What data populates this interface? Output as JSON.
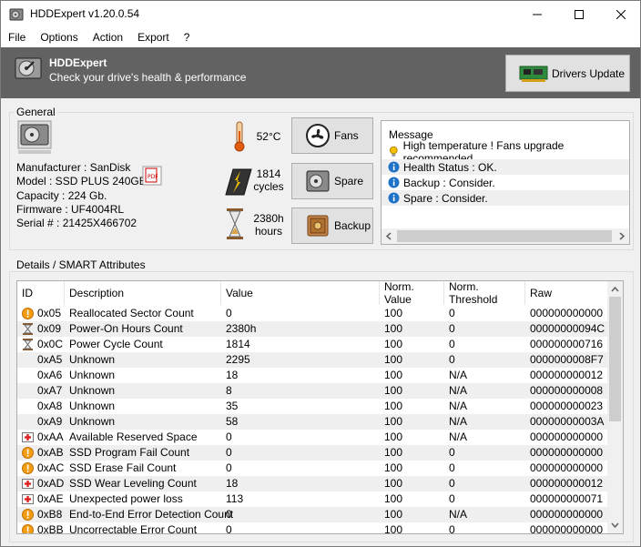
{
  "window": {
    "title": "HDDExpert v1.20.0.54"
  },
  "menu": [
    "File",
    "Options",
    "Action",
    "Export",
    "?"
  ],
  "banner": {
    "title": "HDDExpert",
    "subtitle": "Check your drive's health & performance",
    "drivers_button": "Drivers Update"
  },
  "general": {
    "label": "General",
    "manufacturer": "Manufacturer : SanDisk",
    "model": "Model : SSD PLUS 240GB",
    "capacity": "Capacity : 224 Gb.",
    "firmware": "Firmware : UF4004RL",
    "serial": "Serial # : 21425X466702",
    "temp": "52°C",
    "cycles_value": "1814",
    "cycles_unit": "cycles",
    "hours_value": "2380h",
    "hours_unit": "hours",
    "fans_button": "Fans",
    "spare_button": "Spare",
    "backup_button": "Backup"
  },
  "messages": {
    "header": "Message",
    "items": [
      {
        "icon": "bulb-icon",
        "text": "High temperature ! Fans upgrade recommended"
      },
      {
        "icon": "info-icon",
        "text": "Health Status : OK."
      },
      {
        "icon": "info-icon",
        "text": "Backup : Consider."
      },
      {
        "icon": "info-icon",
        "text": "Spare : Consider."
      }
    ]
  },
  "details": {
    "label": "Details / SMART Attributes",
    "columns": [
      "ID",
      "Description",
      "Value",
      "Norm. Value",
      "Norm. Threshold",
      "Raw"
    ],
    "rows": [
      {
        "icon": "warning",
        "id": "0x05",
        "desc": "Reallocated Sector Count",
        "value": "0",
        "norm": "100",
        "thr": "0",
        "raw": "000000000000"
      },
      {
        "icon": "hourglass",
        "id": "0x09",
        "desc": "Power-On Hours Count",
        "value": "2380h",
        "norm": "100",
        "thr": "0",
        "raw": "00000000094C"
      },
      {
        "icon": "hourglass",
        "id": "0x0C",
        "desc": "Power Cycle Count",
        "value": "1814",
        "norm": "100",
        "thr": "0",
        "raw": "000000000716"
      },
      {
        "icon": "",
        "id": "0xA5",
        "desc": "Unknown",
        "value": "2295",
        "norm": "100",
        "thr": "0",
        "raw": "0000000008F7"
      },
      {
        "icon": "",
        "id": "0xA6",
        "desc": "Unknown",
        "value": "18",
        "norm": "100",
        "thr": "N/A",
        "raw": "000000000012"
      },
      {
        "icon": "",
        "id": "0xA7",
        "desc": "Unknown",
        "value": "8",
        "norm": "100",
        "thr": "N/A",
        "raw": "000000000008"
      },
      {
        "icon": "",
        "id": "0xA8",
        "desc": "Unknown",
        "value": "35",
        "norm": "100",
        "thr": "N/A",
        "raw": "000000000023"
      },
      {
        "icon": "",
        "id": "0xA9",
        "desc": "Unknown",
        "value": "58",
        "norm": "100",
        "thr": "N/A",
        "raw": "00000000003A"
      },
      {
        "icon": "medic",
        "id": "0xAA",
        "desc": "Available Reserved Space",
        "value": "0",
        "norm": "100",
        "thr": "N/A",
        "raw": "000000000000"
      },
      {
        "icon": "warning",
        "id": "0xAB",
        "desc": "SSD Program Fail Count",
        "value": "0",
        "norm": "100",
        "thr": "0",
        "raw": "000000000000"
      },
      {
        "icon": "warning",
        "id": "0xAC",
        "desc": "SSD Erase Fail Count",
        "value": "0",
        "norm": "100",
        "thr": "0",
        "raw": "000000000000"
      },
      {
        "icon": "medic",
        "id": "0xAD",
        "desc": "SSD Wear Leveling Count",
        "value": "18",
        "norm": "100",
        "thr": "0",
        "raw": "000000000012"
      },
      {
        "icon": "medic",
        "id": "0xAE",
        "desc": "Unexpected power loss",
        "value": "113",
        "norm": "100",
        "thr": "0",
        "raw": "000000000071"
      },
      {
        "icon": "warning",
        "id": "0xB8",
        "desc": "End-to-End Error Detection Count",
        "value": "0",
        "norm": "100",
        "thr": "N/A",
        "raw": "000000000000"
      },
      {
        "icon": "warning",
        "id": "0xBB",
        "desc": "Uncorrectable Error Count",
        "value": "0",
        "norm": "100",
        "thr": "0",
        "raw": "000000000000"
      }
    ]
  },
  "colors": {
    "banner": "#626262",
    "warning": "#f39c12",
    "info": "#1e73c8"
  }
}
